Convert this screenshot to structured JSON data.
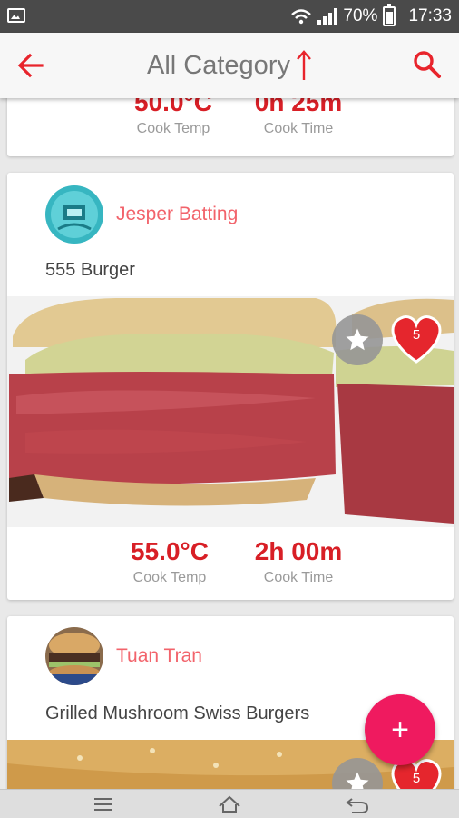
{
  "status": {
    "battery": "70%",
    "time": "17:33"
  },
  "app_bar": {
    "title": "All Category"
  },
  "cards": [
    {
      "cook_temp": "50.0°C",
      "cook_time": "0h 25m",
      "temp_label": "Cook Temp",
      "time_label": "Cook Time"
    },
    {
      "author": "Jesper Batting",
      "title": "555 Burger",
      "likes": "5",
      "cook_temp": "55.0°C",
      "cook_time": "2h 00m",
      "temp_label": "Cook Temp",
      "time_label": "Cook Time"
    },
    {
      "author": "Tuan Tran",
      "title": "Grilled Mushroom Swiss Burgers",
      "likes": "5"
    }
  ],
  "fab": {
    "label": "+"
  },
  "colors": {
    "accent": "#d81f26",
    "author": "#f2636b",
    "fab": "#ef1a5f",
    "heart": "#e5262d"
  },
  "icons": [
    "back-arrow-icon",
    "sort-up-arrow-icon",
    "search-icon",
    "star-icon",
    "heart-icon",
    "plus-icon",
    "menu-icon",
    "home-icon",
    "back-nav-icon",
    "wifi-icon",
    "signal-icon",
    "battery-icon",
    "image-notification-icon"
  ]
}
